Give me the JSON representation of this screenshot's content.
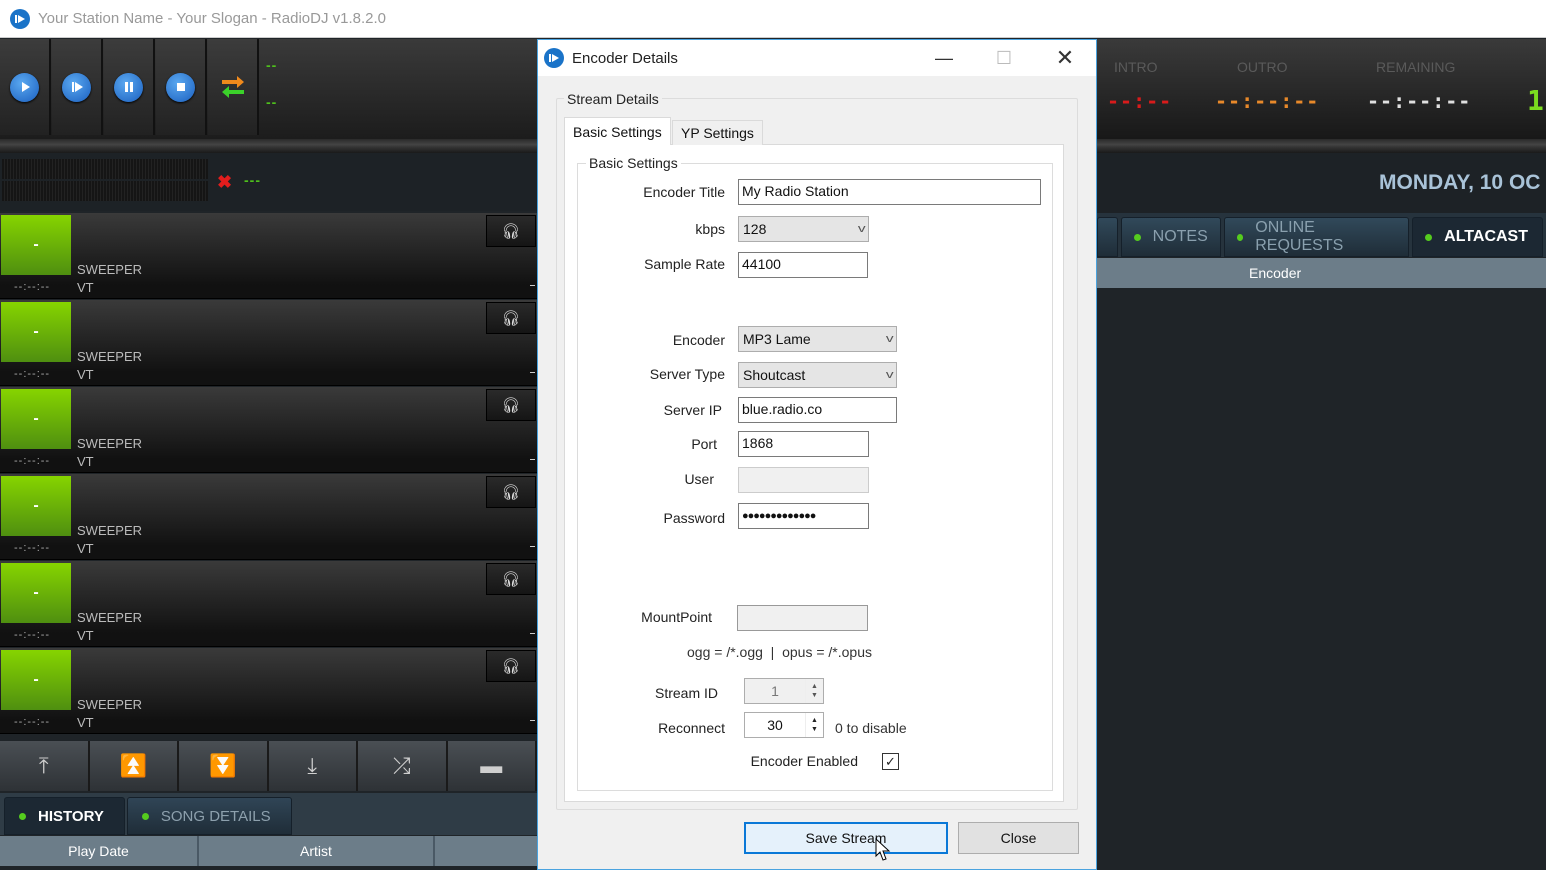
{
  "app": {
    "title": "Your Station Name - Your Slogan - RadioDJ v1.8.2.0"
  },
  "player": {
    "transport_buttons": [
      {
        "name": "play",
        "icon": "play-icon"
      },
      {
        "name": "play-next",
        "icon": "play-next-icon"
      },
      {
        "name": "pause",
        "icon": "pause-icon"
      },
      {
        "name": "stop",
        "icon": "stop-icon"
      },
      {
        "name": "auto-loop",
        "icon": "loop-icon"
      }
    ],
    "readout_top": "--",
    "readout_bottom": "--",
    "meter_status": "---"
  },
  "timers": {
    "intro_label": "INTRO",
    "intro_value": "--:--",
    "outro_label": "OUTRO",
    "outro_value": "--:--:--",
    "remaining_label": "REMAINING",
    "remaining_value": "--:--:--",
    "clock_partial": "1",
    "date": "MONDAY, 10 OC",
    "colors": {
      "intro": "#d81b1b",
      "outro": "#e8892a",
      "remaining": "#e0e0e0",
      "clock": "#7bdc1f"
    }
  },
  "carts": [
    {
      "button": "-",
      "time": "--:--:--",
      "type": "SWEEPER",
      "sub": "VT"
    },
    {
      "button": "-",
      "time": "--:--:--",
      "type": "SWEEPER",
      "sub": "VT"
    },
    {
      "button": "-",
      "time": "--:--:--",
      "type": "SWEEPER",
      "sub": "VT"
    },
    {
      "button": "-",
      "time": "--:--:--",
      "type": "SWEEPER",
      "sub": "VT"
    },
    {
      "button": "-",
      "time": "--:--:--",
      "type": "SWEEPER",
      "sub": "VT"
    },
    {
      "button": "-",
      "time": "--:--:--",
      "type": "SWEEPER",
      "sub": "VT"
    }
  ],
  "move_buttons": [
    {
      "name": "move-top",
      "glyph": "⤒"
    },
    {
      "name": "move-up",
      "glyph": "⏫"
    },
    {
      "name": "move-down",
      "glyph": "⏬"
    },
    {
      "name": "move-bottom",
      "glyph": "⤓"
    },
    {
      "name": "shuffle",
      "glyph": "⤮"
    },
    {
      "name": "folder",
      "glyph": "▬"
    }
  ],
  "left_tabs": [
    {
      "label": "HISTORY",
      "active": true
    },
    {
      "label": "SONG DETAILS",
      "active": false
    }
  ],
  "history_columns": [
    "Play Date",
    "Artist",
    ""
  ],
  "right_tabs": [
    {
      "label": "",
      "active": false
    },
    {
      "label": "NOTES",
      "active": false
    },
    {
      "label": "ONLINE REQUESTS",
      "active": false
    },
    {
      "label": "ALTACAST",
      "active": true
    }
  ],
  "altacast_columns": [
    "Encoder"
  ],
  "dialog": {
    "title": "Encoder Details",
    "group_label": "Stream Details",
    "tabs": [
      {
        "label": "Basic Settings",
        "active": true
      },
      {
        "label": "YP Settings",
        "active": false
      }
    ],
    "inner_group_label": "Basic Settings",
    "fields": {
      "encoder_title": {
        "label": "Encoder Title",
        "value": "My Radio Station"
      },
      "kbps": {
        "label": "kbps",
        "value": "128"
      },
      "sample_rate": {
        "label": "Sample Rate",
        "value": "44100"
      },
      "encoder": {
        "label": "Encoder",
        "value": "MP3 Lame"
      },
      "server_type": {
        "label": "Server Type",
        "value": "Shoutcast"
      },
      "server_ip": {
        "label": "Server IP",
        "value": "blue.radio.co"
      },
      "port": {
        "label": "Port",
        "value": "1868"
      },
      "user": {
        "label": "User",
        "value": ""
      },
      "password": {
        "label": "Password",
        "value": "●●●●●●●●●●●●●"
      },
      "mountpoint": {
        "label": "MountPoint",
        "value": ""
      },
      "mount_hint": "ogg = /*.ogg  |  opus = /*.opus",
      "stream_id": {
        "label": "Stream ID",
        "value": "1"
      },
      "reconnect": {
        "label": "Reconnect",
        "value": "30",
        "hint": "0 to disable"
      },
      "encoder_enabled": {
        "label": "Encoder Enabled",
        "checked": true
      }
    },
    "buttons": {
      "save": "Save Stream",
      "close": "Close"
    }
  }
}
